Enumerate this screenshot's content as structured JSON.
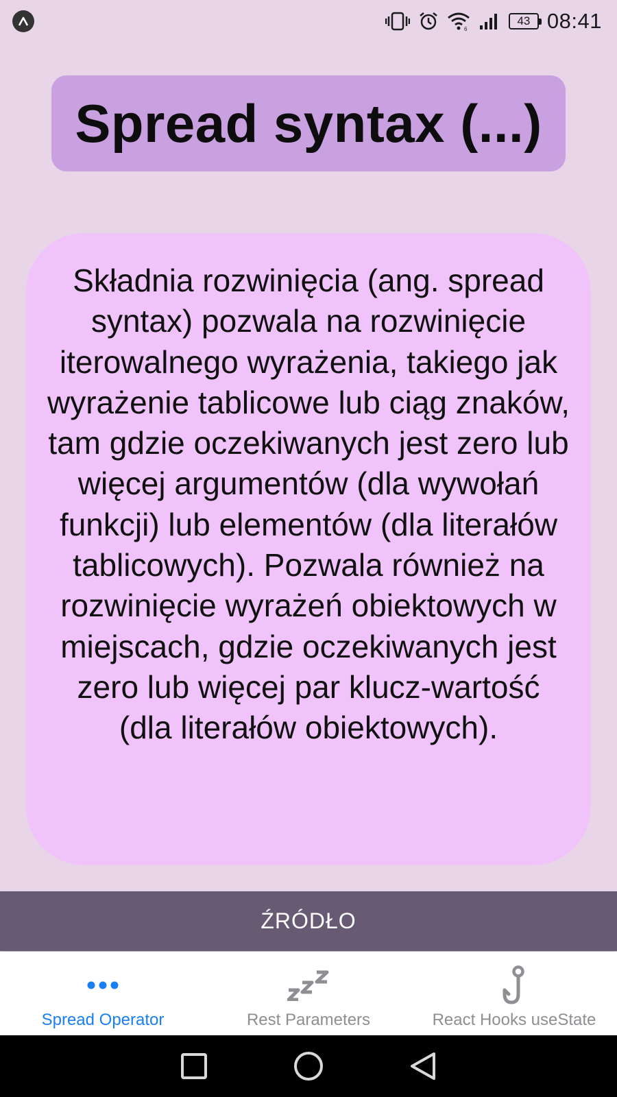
{
  "status_bar": {
    "battery_level": "43",
    "time": "08:41"
  },
  "title": "Spread syntax (...)",
  "description": "Składnia rozwinięcia (ang. spread syntax) pozwala na rozwinięcie iterowalnego wyrażenia, takiego jak wyrażenie tablicowe lub ciąg znaków, tam gdzie oczekiwanych jest zero lub więcej argumentów (dla wywołań funkcji) lub elementów (dla literałów tablicowych). Pozwala również na rozwinięcie wyrażeń obiektowych w miejscach, gdzie oczekiwanych jest zero lub więcej par klucz-wartość (dla literałów obiektowych).",
  "source_button_label": "ŹRÓDŁO",
  "tabs": [
    {
      "label": "Spread Operator",
      "icon": "ellipsis-icon",
      "active": true
    },
    {
      "label": "Rest Parameters",
      "icon": "zzz-icon",
      "active": false
    },
    {
      "label": "React Hooks useState",
      "icon": "hook-icon",
      "active": false
    }
  ],
  "colors": {
    "background": "#e8d6e8",
    "title_card": "#c9a0e0",
    "description_card": "#f0c4fa",
    "source_button": "#665b73",
    "active_tab": "#1a7ff0",
    "inactive_tab": "#8e8e93"
  }
}
